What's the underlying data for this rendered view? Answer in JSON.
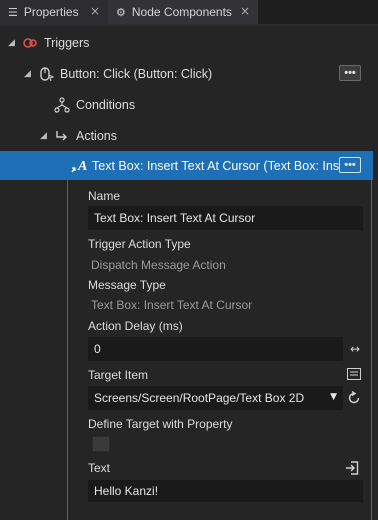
{
  "tabs": [
    {
      "label": "Properties",
      "icon": "list-icon",
      "close": "×"
    },
    {
      "label": "Node Components",
      "icon": "components-icon",
      "close": "×"
    }
  ],
  "tree": {
    "triggers": {
      "label": "Triggers",
      "caret": "◢"
    },
    "trigger": {
      "label": "Button: Click (Button: Click)",
      "caret": "◢",
      "more": "•••"
    },
    "conditions": {
      "label": "Conditions"
    },
    "actions": {
      "label": "Actions",
      "caret": "◢"
    },
    "action": {
      "label": "Text Box: Insert Text At Cursor (Text Box: Insert",
      "more": "•••"
    }
  },
  "properties": {
    "name": {
      "label": "Name",
      "value": "Text Box: Insert Text At Cursor"
    },
    "trigger_action_type": {
      "label": "Trigger Action Type",
      "value": "Dispatch Message Action"
    },
    "message_type": {
      "label": "Message Type",
      "value": "Text Box: Insert Text At Cursor"
    },
    "action_delay": {
      "label": "Action Delay (ms)",
      "value": "0",
      "icon": "↔"
    },
    "target_item": {
      "label": "Target Item",
      "value": "Screens/Screen/RootPage/Text Box 2D",
      "dropdown": "▼"
    },
    "define_target": {
      "label": "Define Target with Property"
    },
    "text": {
      "label": "Text",
      "value": "Hello Kanzi!"
    }
  },
  "colors": {
    "selection": "#1f6fb7",
    "background": "#252526",
    "field": "#1a1a1a"
  }
}
